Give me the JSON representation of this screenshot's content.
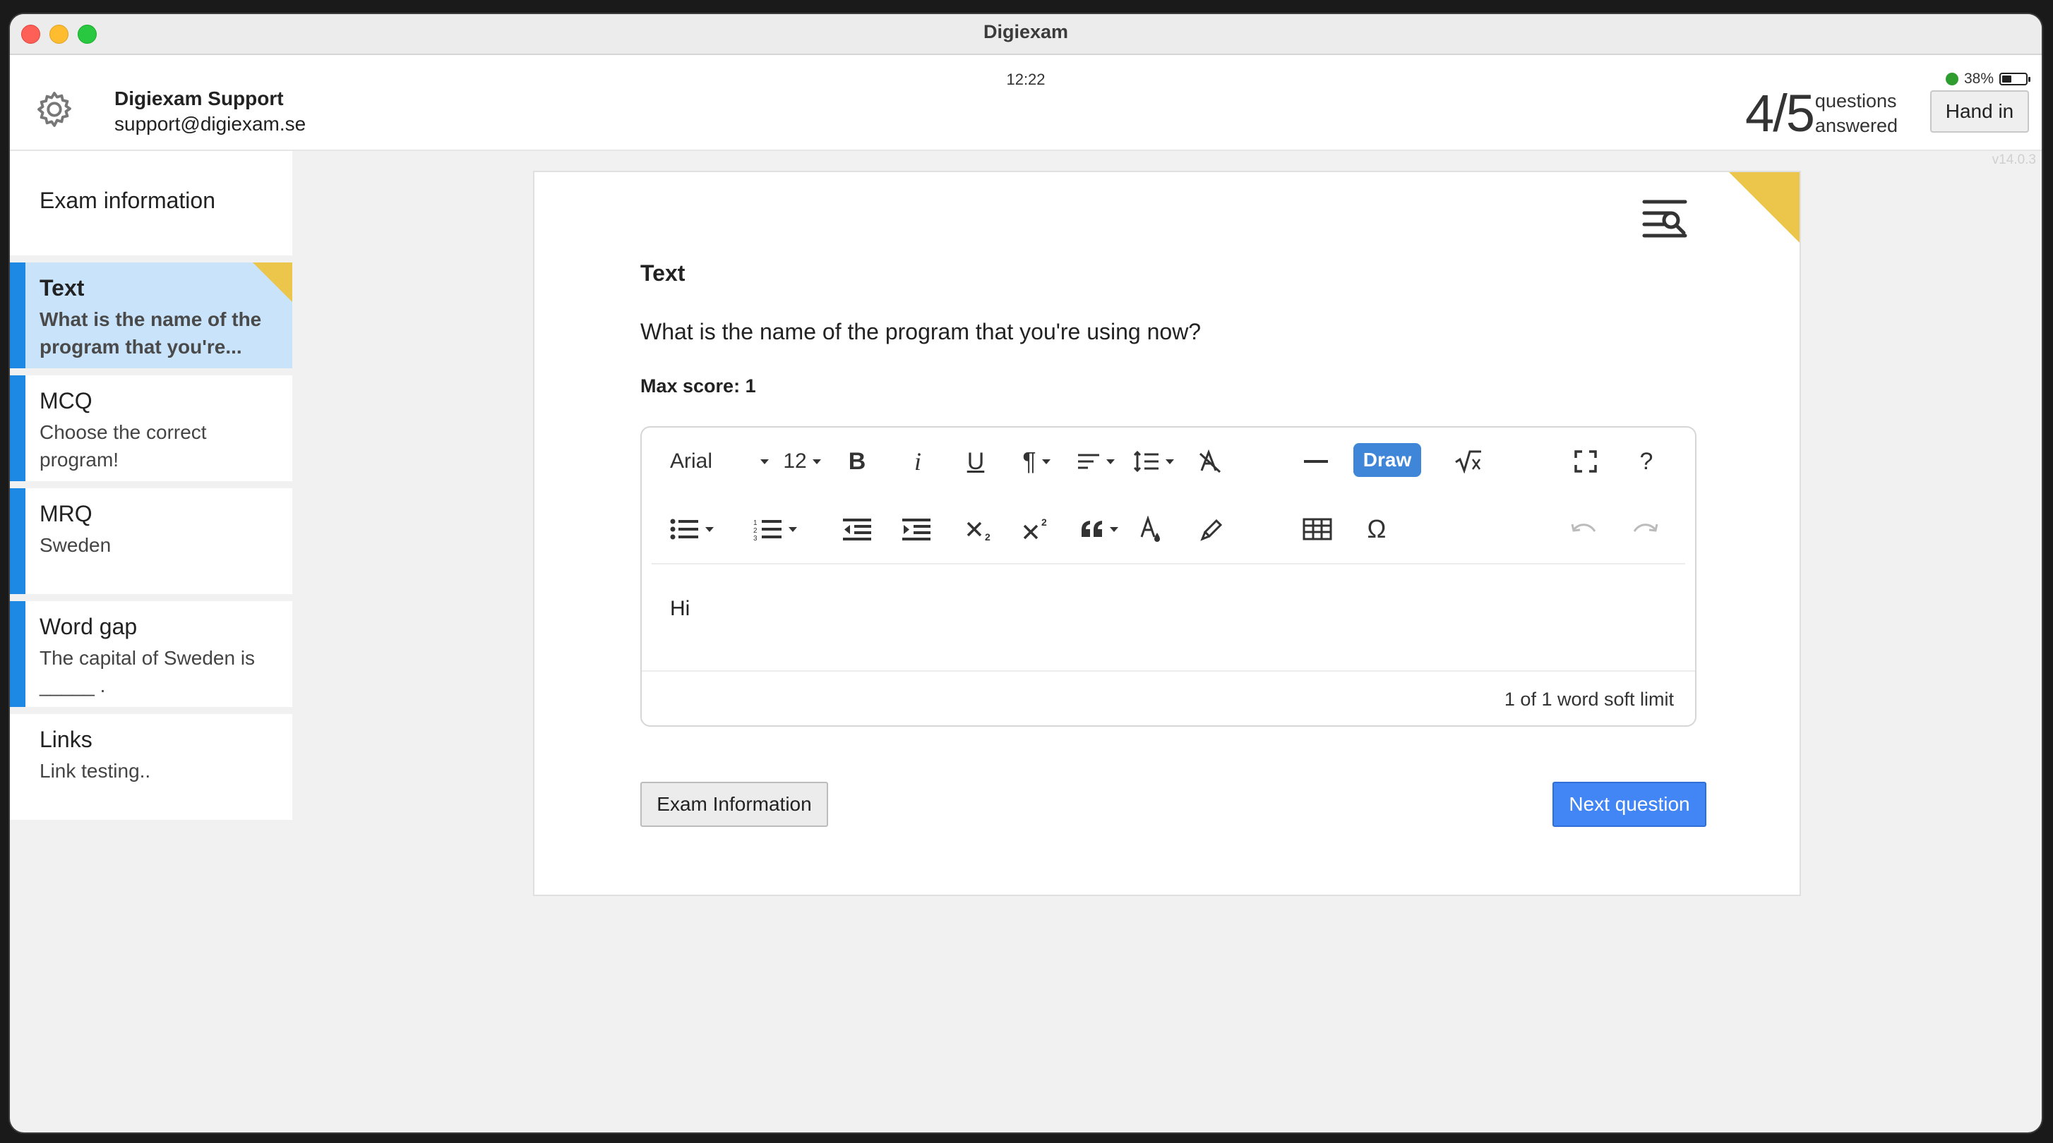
{
  "window": {
    "title": "Digiexam"
  },
  "status": {
    "time": "12:22",
    "battery": "38%"
  },
  "user": {
    "name": "Digiexam Support",
    "email": "support@digiexam.se"
  },
  "progress": {
    "count": "4/5",
    "label_line1": "questions",
    "label_line2": "answered"
  },
  "header": {
    "hand_in_label": "Hand in",
    "version": "v14.0.3"
  },
  "sidebar": {
    "exam_info_label": "Exam information",
    "questions": [
      {
        "title": "Text",
        "subtitle": "What is the name of the program that you're...",
        "active": true
      },
      {
        "title": "MCQ",
        "subtitle": "Choose the correct program!"
      },
      {
        "title": "MRQ",
        "subtitle": "Sweden"
      },
      {
        "title": "Word gap",
        "subtitle": "The capital of Sweden is _____ ."
      },
      {
        "title": "Links",
        "subtitle": "Link testing.."
      }
    ]
  },
  "question": {
    "type_label": "Text",
    "text": "What is the name of the program that you're using now?",
    "max_score": "Max score: 1"
  },
  "editor": {
    "font_family": "Arial",
    "font_size": "12",
    "bold": "B",
    "italic": "i",
    "underline": "U",
    "paragraph": "¶",
    "draw_label": "Draw",
    "help": "?",
    "special_char": "Ω",
    "content": "Hi",
    "word_limit": "1 of 1 word soft limit"
  },
  "footer": {
    "exam_info_button": "Exam Information",
    "next_button": "Next question"
  },
  "colors": {
    "accent_blue": "#1e88e5",
    "flag_yellow": "#ecc54b",
    "next_button": "#4285f4",
    "active_item": "#c9e3fb"
  }
}
